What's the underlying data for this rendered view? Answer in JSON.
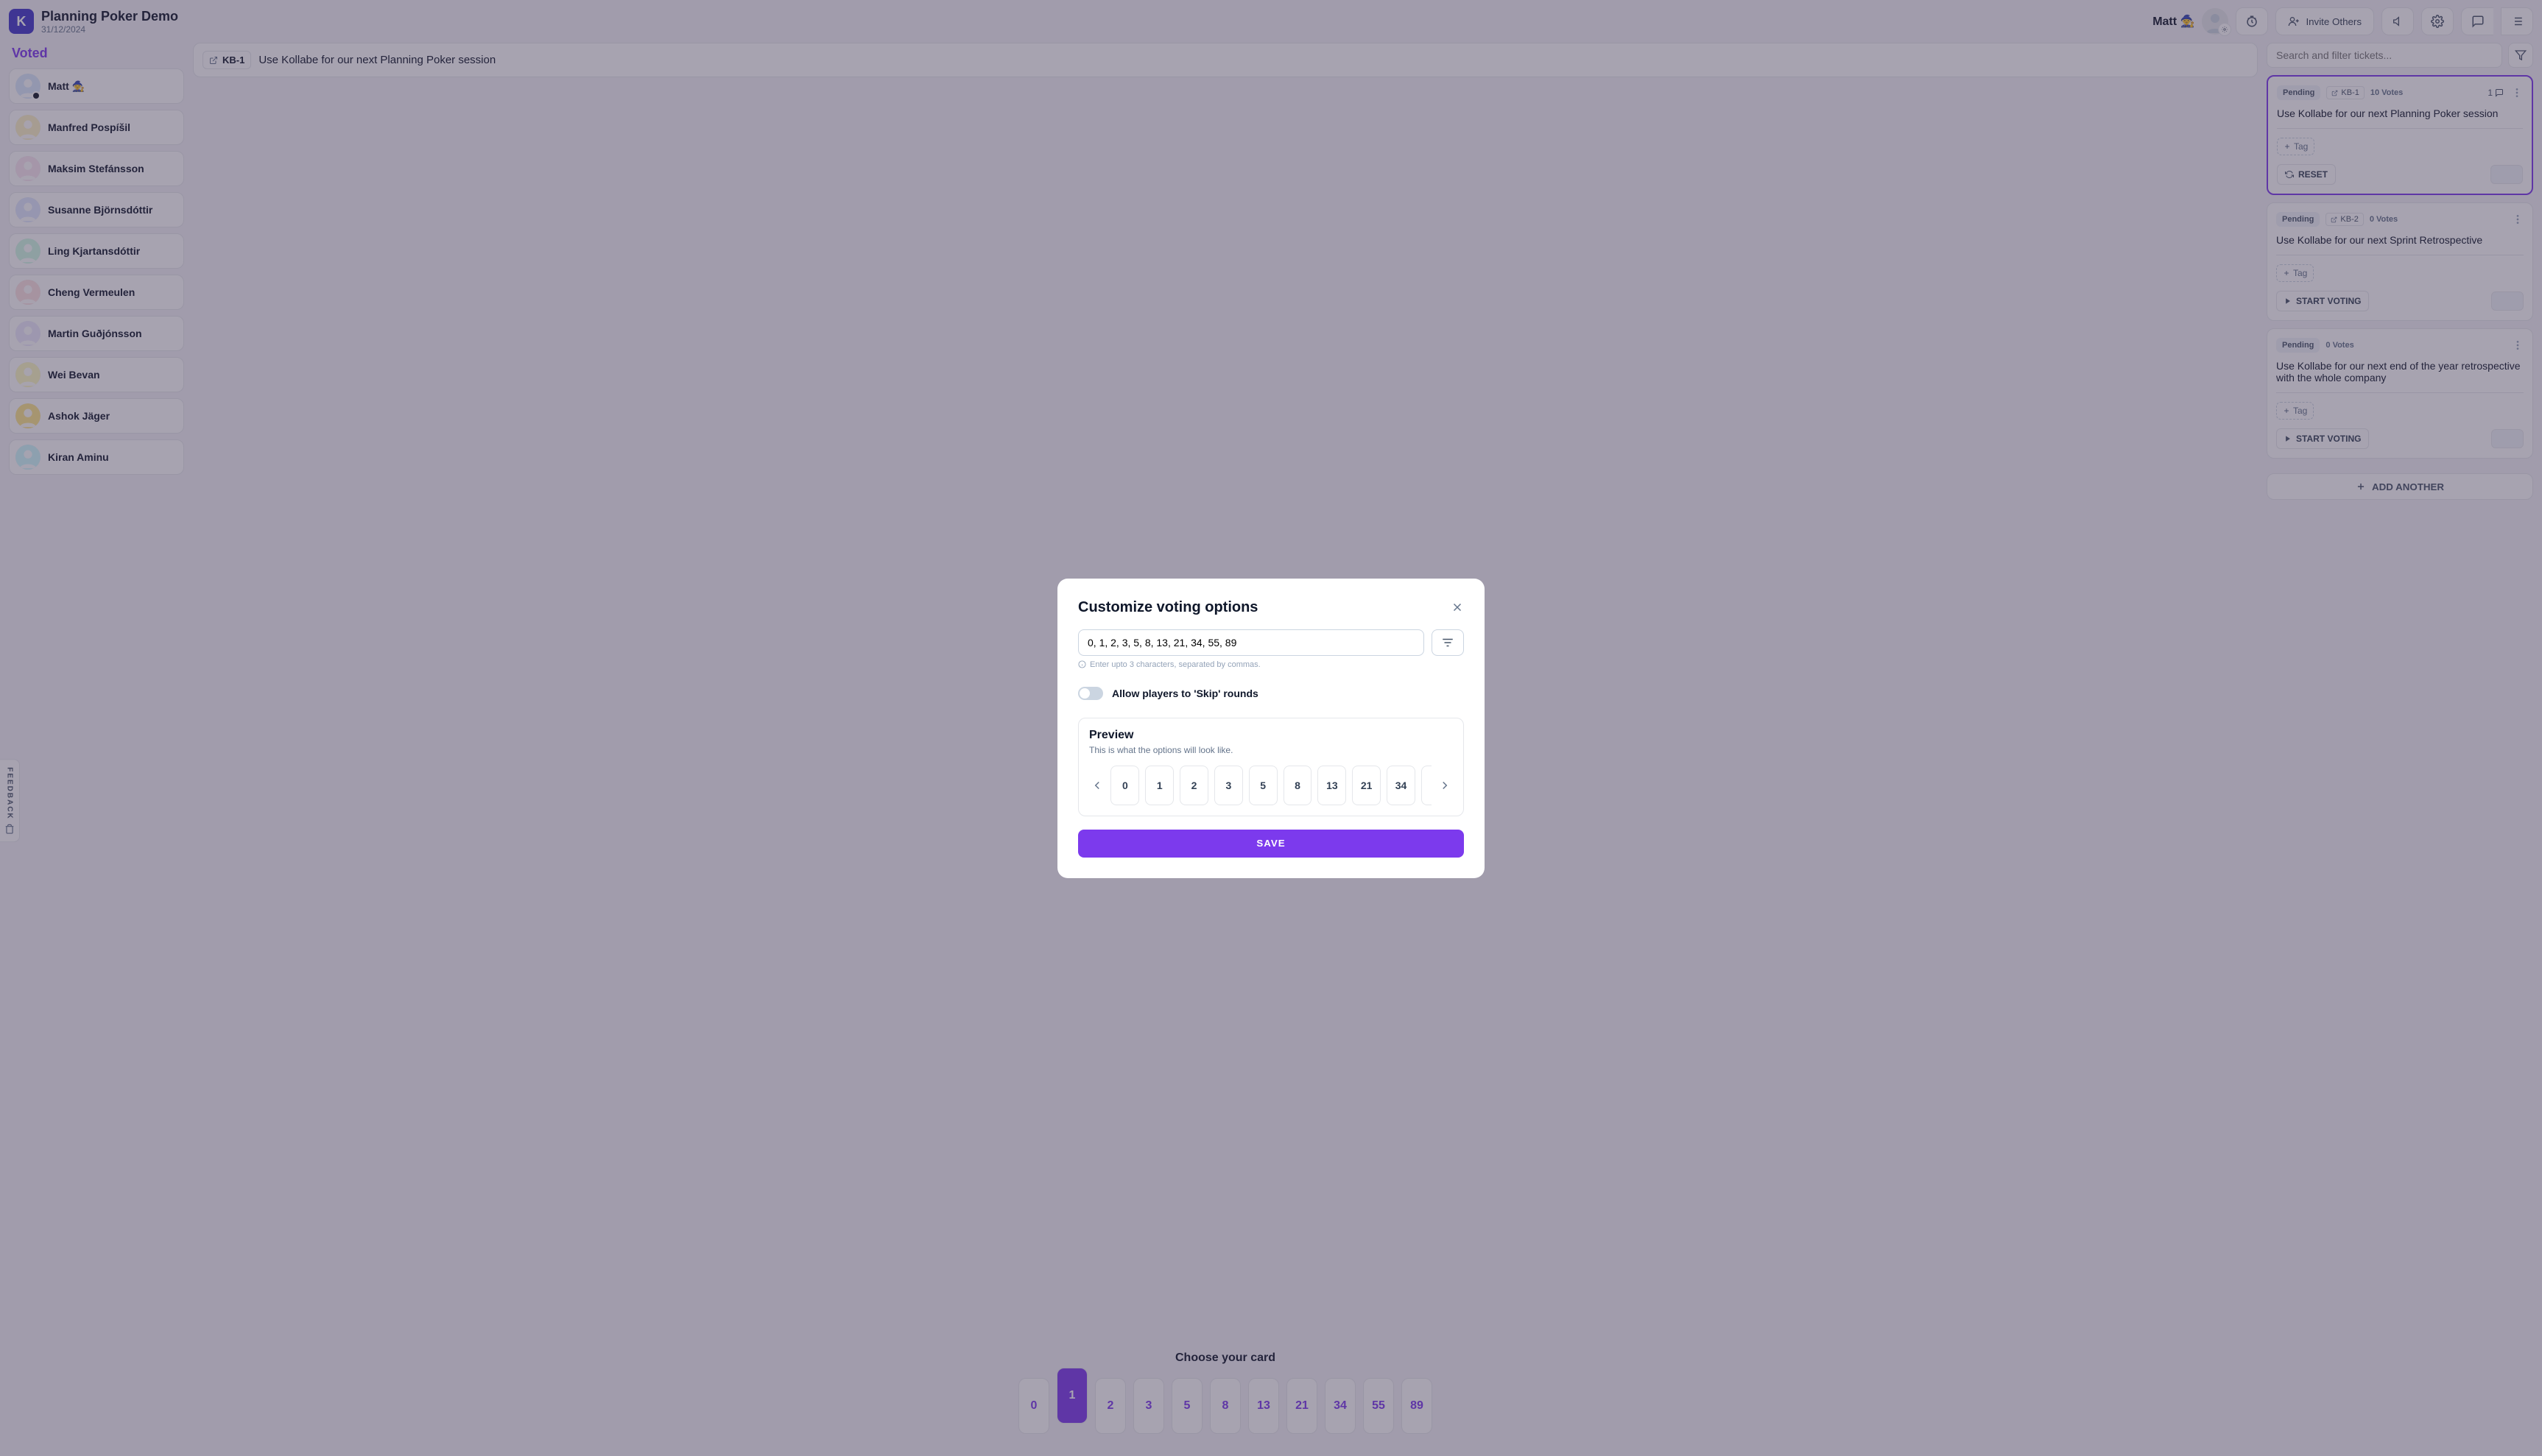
{
  "header": {
    "logo_letter": "K",
    "title": "Planning Poker Demo",
    "date": "31/12/2024",
    "user_display": "Matt 🧙",
    "invite_label": "Invite Others"
  },
  "sidebar": {
    "heading": "Voted",
    "players": [
      {
        "name": "Matt 🧙",
        "me": true
      },
      {
        "name": "Manfred Pospíšil",
        "me": false
      },
      {
        "name": "Maksim Stefánsson",
        "me": false
      },
      {
        "name": "Susanne Björnsdóttir",
        "me": false
      },
      {
        "name": "Ling Kjartansdóttir",
        "me": false
      },
      {
        "name": "Cheng Vermeulen",
        "me": false
      },
      {
        "name": "Martin Guðjónsson",
        "me": false
      },
      {
        "name": "Wei Bevan",
        "me": false
      },
      {
        "name": "Ashok Jäger",
        "me": false
      },
      {
        "name": "Kiran Aminu",
        "me": false
      }
    ]
  },
  "center": {
    "ticket_ref": "KB-1",
    "ticket_title": "Use Kollabe for our next Planning Poker session",
    "prompt": "Choose your card",
    "cards": [
      "0",
      "1",
      "2",
      "3",
      "5",
      "8",
      "13",
      "21",
      "34",
      "55",
      "89"
    ],
    "selected_index": 1
  },
  "right": {
    "search_placeholder": "Search and filter tickets...",
    "add_another": "ADD ANOTHER",
    "tickets": [
      {
        "status": "Pending",
        "ref": "KB-1",
        "votes": "10 Votes",
        "comment_count": "1",
        "title": "Use Kollabe for our next Planning Poker session",
        "tag_label": "Tag",
        "action_label": "RESET",
        "action_icon": "refresh",
        "active": true,
        "has_ref": true,
        "has_comment": true
      },
      {
        "status": "Pending",
        "ref": "KB-2",
        "votes": "0 Votes",
        "title": "Use Kollabe for our next Sprint Retrospective",
        "tag_label": "Tag",
        "action_label": "START VOTING",
        "action_icon": "play",
        "active": false,
        "has_ref": true,
        "has_comment": false
      },
      {
        "status": "Pending",
        "votes": "0 Votes",
        "title": "Use Kollabe for our next end of the year retrospective with the whole company",
        "tag_label": "Tag",
        "action_label": "START VOTING",
        "action_icon": "play",
        "active": false,
        "has_ref": false,
        "has_comment": false
      }
    ]
  },
  "modal": {
    "title": "Customize voting options",
    "input_value": "0, 1, 2, 3, 5, 8, 13, 21, 34, 55, 89",
    "hint": "Enter upto 3 characters, separated by commas.",
    "toggle_label": "Allow players to 'Skip' rounds",
    "preview_title": "Preview",
    "preview_sub": "This is what the options will look like.",
    "preview_cards": [
      "0",
      "1",
      "2",
      "3",
      "5",
      "8",
      "13",
      "21",
      "34"
    ],
    "save_label": "SAVE"
  },
  "feedback": {
    "label": "FEEDBACK"
  },
  "avatar_colors": [
    "#dbeafe",
    "#fef3c7",
    "#fce7f3",
    "#e0e7ff",
    "#d1fae5",
    "#fee2e2",
    "#ede9fe",
    "#fef9c3",
    "#fde68a",
    "#cffafe"
  ]
}
